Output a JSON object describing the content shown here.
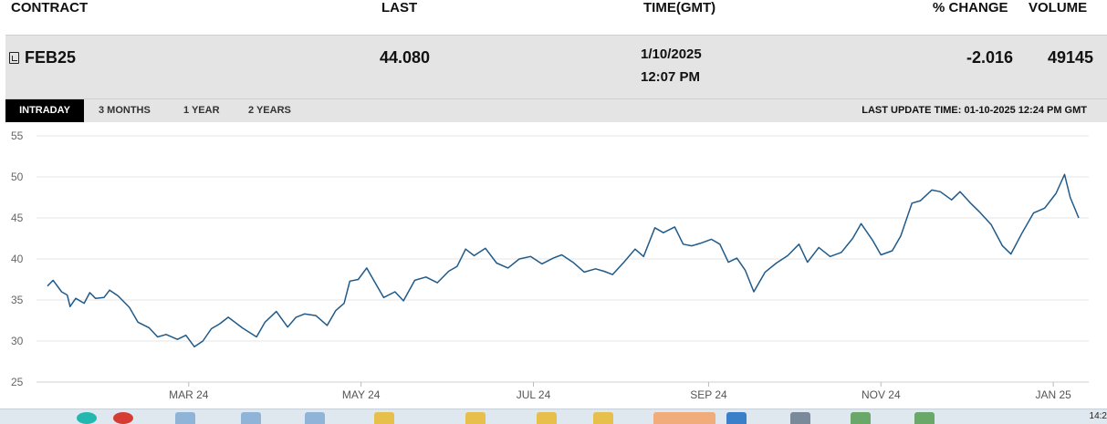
{
  "header": {
    "contract": "CONTRACT",
    "last": "LAST",
    "time": "TIME(GMT)",
    "change": "% CHANGE",
    "volume": "VOLUME"
  },
  "quote": {
    "contract": "FEB25",
    "last": "44.080",
    "date": "1/10/2025",
    "time": "12:07 PM",
    "change": "-2.016",
    "volume": "49145"
  },
  "tabs": [
    {
      "label": "INTRADAY",
      "active": true
    },
    {
      "label": "3 MONTHS",
      "active": false
    },
    {
      "label": "1 YEAR",
      "active": false
    },
    {
      "label": "2 YEARS",
      "active": false
    }
  ],
  "last_update": "LAST UPDATE TIME: 01-10-2025 12:24 PM GMT",
  "taskbar": {
    "clock": "14:2"
  },
  "colors": {
    "line": "#1f5a8a",
    "panel": "#e4e4e4",
    "active_tab": "#000000",
    "grid": "#e6e6e6"
  },
  "chart_data": {
    "type": "line",
    "title": "",
    "xlabel": "",
    "ylabel": "",
    "ylim": [
      25,
      55
    ],
    "yticks": [
      25,
      30,
      35,
      40,
      45,
      50,
      55
    ],
    "xlim": [
      "2024-01-11",
      "2025-01-10"
    ],
    "xticks": [
      {
        "label": "MAR 24",
        "date": "2024-03-01"
      },
      {
        "label": "MAY 24",
        "date": "2024-05-01"
      },
      {
        "label": "JUL 24",
        "date": "2024-07-01"
      },
      {
        "label": "SEP 24",
        "date": "2024-09-01"
      },
      {
        "label": "NOV 24",
        "date": "2024-11-01"
      },
      {
        "label": "JAN 25",
        "date": "2025-01-01"
      }
    ],
    "grid": true,
    "series": [
      {
        "x": [
          "2024-01-11",
          "2024-01-13",
          "2024-01-16",
          "2024-01-18",
          "2024-01-19",
          "2024-01-21",
          "2024-01-24",
          "2024-01-26",
          "2024-01-28",
          "2024-01-31",
          "2024-02-02",
          "2024-02-05",
          "2024-02-09",
          "2024-02-12",
          "2024-02-16",
          "2024-02-19",
          "2024-02-22",
          "2024-02-26",
          "2024-02-29",
          "2024-03-03",
          "2024-03-06",
          "2024-03-09",
          "2024-03-12",
          "2024-03-15",
          "2024-03-20",
          "2024-03-25",
          "2024-03-28",
          "2024-04-01",
          "2024-04-05",
          "2024-04-08",
          "2024-04-11",
          "2024-04-15",
          "2024-04-19",
          "2024-04-22",
          "2024-04-25",
          "2024-04-27",
          "2024-04-30",
          "2024-05-03",
          "2024-05-06",
          "2024-05-09",
          "2024-05-13",
          "2024-05-16",
          "2024-05-20",
          "2024-05-24",
          "2024-05-28",
          "2024-06-01",
          "2024-06-04",
          "2024-06-07",
          "2024-06-10",
          "2024-06-14",
          "2024-06-18",
          "2024-06-22",
          "2024-06-26",
          "2024-06-30",
          "2024-07-04",
          "2024-07-08",
          "2024-07-11",
          "2024-07-15",
          "2024-07-19",
          "2024-07-23",
          "2024-07-26",
          "2024-07-29",
          "2024-08-02",
          "2024-08-06",
          "2024-08-09",
          "2024-08-13",
          "2024-08-16",
          "2024-08-20",
          "2024-08-23",
          "2024-08-26",
          "2024-08-29",
          "2024-09-02",
          "2024-09-05",
          "2024-09-08",
          "2024-09-11",
          "2024-09-14",
          "2024-09-17",
          "2024-09-21",
          "2024-09-25",
          "2024-09-29",
          "2024-10-03",
          "2024-10-06",
          "2024-10-10",
          "2024-10-14",
          "2024-10-18",
          "2024-10-22",
          "2024-10-25",
          "2024-10-29",
          "2024-11-01",
          "2024-11-05",
          "2024-11-08",
          "2024-11-12",
          "2024-11-15",
          "2024-11-19",
          "2024-11-22",
          "2024-11-26",
          "2024-11-29",
          "2024-12-03",
          "2024-12-06",
          "2024-12-10",
          "2024-12-14",
          "2024-12-17",
          "2024-12-21",
          "2024-12-25",
          "2024-12-29",
          "2025-01-02",
          "2025-01-05",
          "2025-01-07",
          "2025-01-10"
        ],
        "values": [
          36.7,
          37.4,
          36.0,
          35.6,
          34.2,
          35.2,
          34.6,
          35.9,
          35.2,
          35.3,
          36.2,
          35.5,
          34.1,
          32.3,
          31.6,
          30.5,
          30.8,
          30.2,
          30.7,
          29.3,
          30.0,
          31.5,
          32.1,
          32.9,
          31.6,
          30.5,
          32.3,
          33.6,
          31.7,
          32.9,
          33.3,
          33.1,
          31.9,
          33.7,
          34.6,
          37.3,
          37.5,
          38.9,
          37.1,
          35.3,
          36.0,
          34.9,
          37.4,
          37.8,
          37.1,
          38.5,
          39.1,
          41.2,
          40.4,
          41.3,
          39.5,
          38.9,
          40.0,
          40.3,
          39.4,
          40.1,
          40.5,
          39.6,
          38.4,
          38.8,
          38.5,
          38.1,
          39.6,
          41.2,
          40.3,
          43.8,
          43.2,
          43.9,
          41.8,
          41.6,
          41.9,
          42.4,
          41.8,
          39.6,
          40.1,
          38.6,
          36.0,
          38.4,
          39.5,
          40.4,
          41.8,
          39.6,
          41.4,
          40.3,
          40.8,
          42.5,
          44.3,
          42.3,
          40.5,
          41.0,
          42.8,
          46.8,
          47.1,
          48.4,
          48.2,
          47.2,
          48.2,
          46.7,
          45.7,
          44.2,
          41.6,
          40.6,
          43.2,
          45.6,
          46.2,
          48.0,
          50.3,
          47.5,
          45.0
        ]
      }
    ]
  }
}
